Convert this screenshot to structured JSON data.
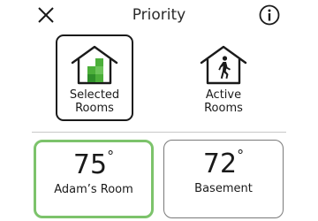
{
  "header": {
    "title": "Priority",
    "close_icon": "close-icon",
    "info_icon": "info-icon"
  },
  "modes": [
    {
      "label_line1": "Selected",
      "label_line2": "Rooms",
      "icon": "house-selected-rooms-icon",
      "selected": true
    },
    {
      "label_line1": "Active",
      "label_line2": "Rooms",
      "icon": "house-person-walking-icon",
      "selected": false
    }
  ],
  "rooms": [
    {
      "temperature": "75",
      "degree_symbol": "°",
      "name": "Adam’s Room",
      "active": true
    },
    {
      "temperature": "72",
      "degree_symbol": "°",
      "name": "Basement",
      "active": false
    }
  ],
  "colors": {
    "accent_green": "#7cc36b",
    "icon_green": "#4caf3a",
    "text": "#1a1a1a",
    "divider": "#c8c8c8"
  }
}
